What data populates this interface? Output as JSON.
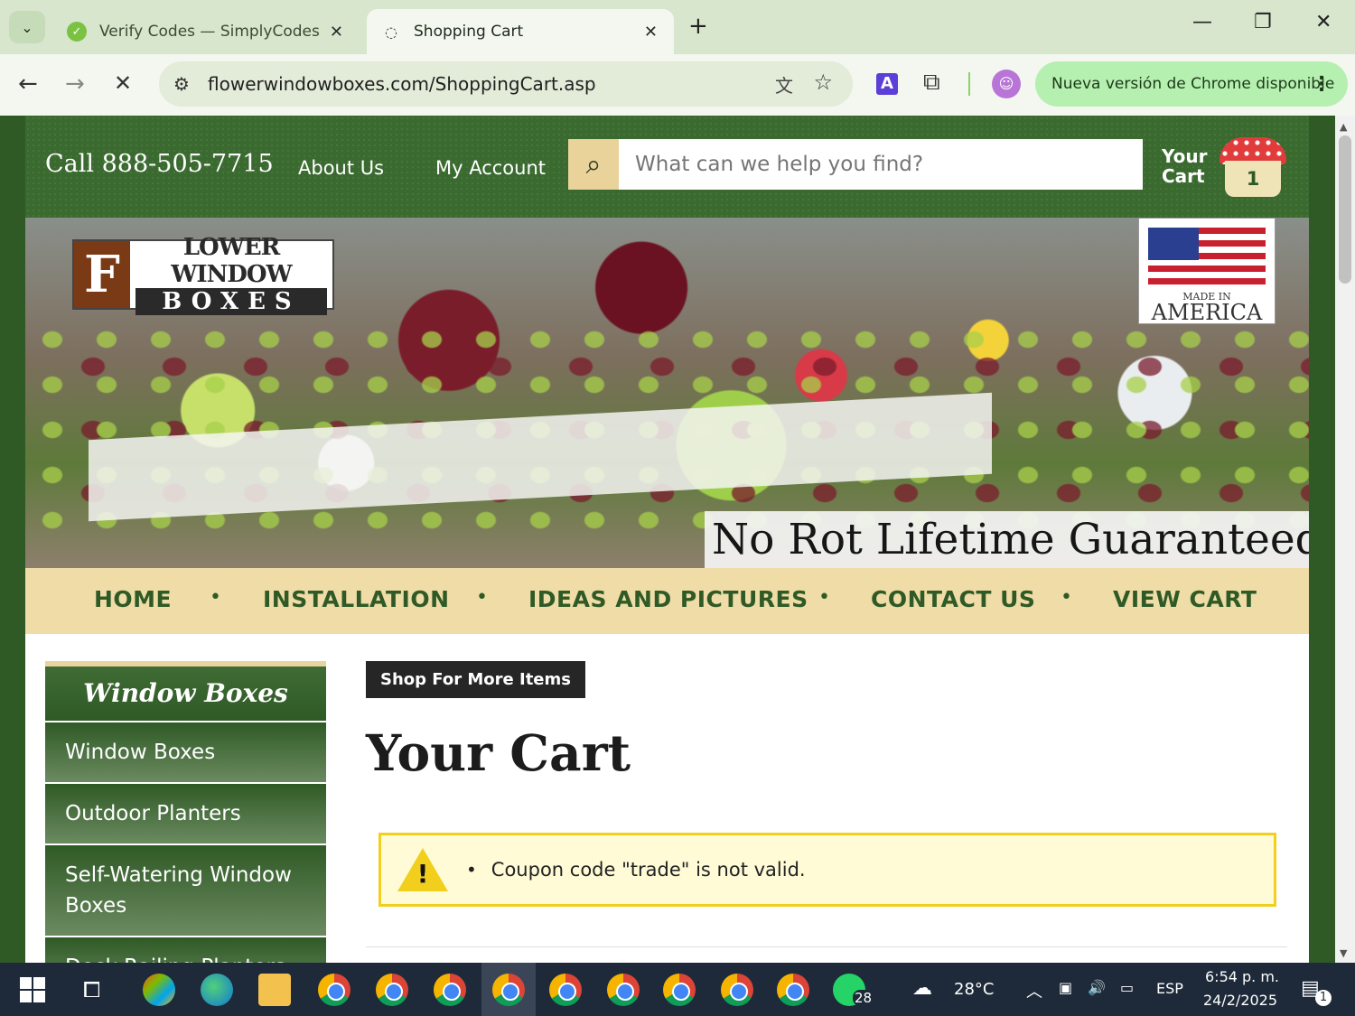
{
  "browser": {
    "tabs": [
      {
        "title": "Verify Codes — SimplyCodes",
        "active": false
      },
      {
        "title": "Shopping Cart",
        "active": true
      }
    ],
    "url": "flowerwindowboxes.com/ShoppingCart.asp",
    "update_label": "Nueva versión de Chrome disponible",
    "colors": {
      "tab_strip": "#d7e6cd",
      "toolbar": "#f3f7ef",
      "update_pill": "#b6f0b0"
    }
  },
  "header": {
    "phone": "Call 888-505-7715",
    "links": [
      "About Us",
      "My Account"
    ],
    "search_placeholder": "What can we help you find?",
    "cart_label_line1": "Your",
    "cart_label_line2": "Cart",
    "cart_count": "1"
  },
  "hero": {
    "logo_line1": "LOWER WINDOW",
    "logo_line2": "BOXES",
    "logo_initial": "F",
    "badge_line1": "MADE IN",
    "badge_line2": "AMERICA",
    "tagline": "No Rot Lifetime Guaranteed!"
  },
  "nav": {
    "items": [
      "HOME",
      "INSTALLATION",
      "IDEAS AND PICTURES",
      "CONTACT US",
      "VIEW CART"
    ],
    "separator": "•"
  },
  "sidebar": {
    "heading": "Window Boxes",
    "items": [
      "Window Boxes",
      "Outdoor Planters",
      "Self-Watering Window Boxes",
      "Deck Railing Planters"
    ]
  },
  "main": {
    "shop_button": "Shop For More Items",
    "title": "Your Cart",
    "alert_message": "Coupon code \"trade\" is not valid.",
    "alert_icon": "!"
  },
  "taskbar": {
    "temperature": "28°C",
    "language": "ESP",
    "time": "6:54 p. m.",
    "date": "24/2/2025",
    "whatsapp_badge": "28",
    "notification_badge": "1"
  },
  "colors": {
    "site_green": "#2f5a26",
    "nav_tan": "#efdca7",
    "alert_border": "#f2cf1d",
    "alert_bg": "#fffbd6"
  }
}
